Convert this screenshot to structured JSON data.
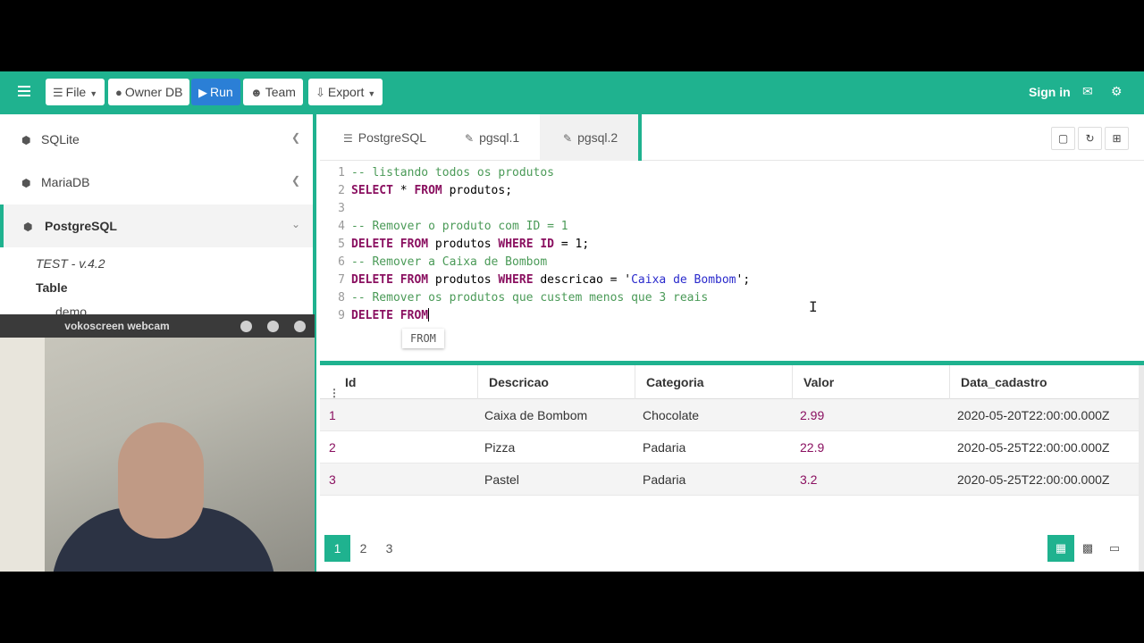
{
  "toolbar": {
    "file": "File",
    "owner_db": "Owner DB",
    "run": "Run",
    "team": "Team",
    "export": "Export",
    "sign_in": "Sign in"
  },
  "sidebar": {
    "items": [
      {
        "label": "SQLite"
      },
      {
        "label": "MariaDB"
      },
      {
        "label": "PostgreSQL"
      }
    ],
    "version": "TEST - v.4.2",
    "section": "Table",
    "table_item": "demo"
  },
  "webcam": {
    "title": "vokoscreen webcam"
  },
  "editor": {
    "tabs": [
      "PostgreSQL",
      "pgsql.1",
      "pgsql.2"
    ],
    "line_numbers": [
      "1",
      "2",
      "3",
      "4",
      "5",
      "6",
      "7",
      "8",
      "9"
    ],
    "lines": [
      "-- listando todos os produtos",
      "SELECT * FROM produtos;",
      "",
      "-- Remover o produto com ID = 1",
      "DELETE FROM produtos WHERE ID = 1;",
      "-- Remover a Caixa de Bombom",
      "DELETE FROM produtos WHERE descricao = 'Caixa de Bombom';",
      "-- Remover os produtos que custem menos que 3 reais",
      "DELETE FROM"
    ],
    "autocomplete_hint": "FROM"
  },
  "results": {
    "columns": [
      "Id",
      "Descricao",
      "Categoria",
      "Valor",
      "Data_cadastro"
    ],
    "rows": [
      [
        "1",
        "Caixa de Bombom",
        "Chocolate",
        "2.99",
        "2020-05-20T22:00:00.000Z"
      ],
      [
        "2",
        "Pizza",
        "Padaria",
        "22.9",
        "2020-05-25T22:00:00.000Z"
      ],
      [
        "3",
        "Pastel",
        "Padaria",
        "3.2",
        "2020-05-25T22:00:00.000Z"
      ]
    ],
    "pages": [
      "1",
      "2",
      "3"
    ],
    "current_page": "1"
  },
  "colors": {
    "accent": "#1fb28f",
    "run_button": "#2b7fd6",
    "keyword": "#8a1060",
    "comment": "#4a9a57",
    "string": "#2a2acc"
  },
  "icons": [
    "hamburger-icon",
    "database-icon",
    "globe-icon",
    "play-icon",
    "users-icon",
    "download-icon",
    "envelope-icon",
    "gear-icon",
    "cube-icon",
    "chevron-left-icon",
    "chevron-down-icon",
    "list-icon",
    "edit-icon",
    "save-icon",
    "refresh-icon",
    "plus-square-icon",
    "table-icon",
    "bar-chart-icon",
    "book-icon"
  ]
}
